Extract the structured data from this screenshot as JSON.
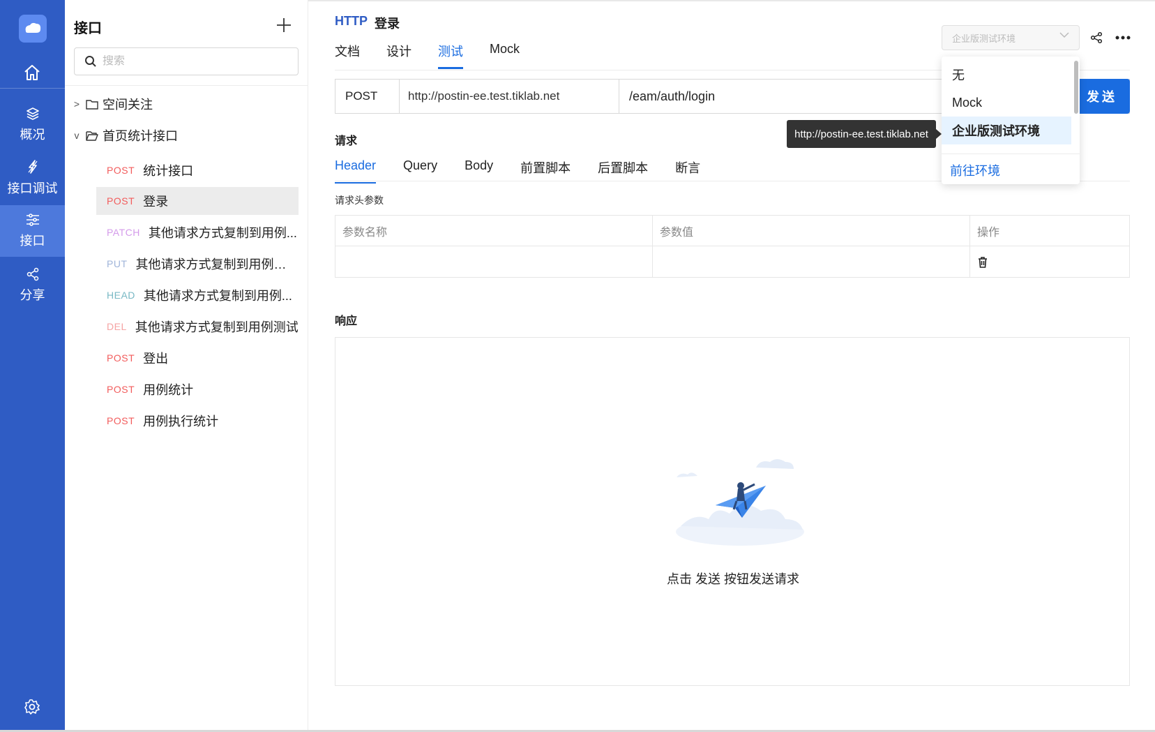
{
  "rail": {
    "items": [
      {
        "label": "概况",
        "icon": "layers-icon"
      },
      {
        "label": "接口调试",
        "icon": "lightning-icon"
      },
      {
        "label": "接口",
        "icon": "sliders-icon"
      },
      {
        "label": "分享",
        "icon": "share-icon"
      }
    ],
    "colors": {
      "background": "#2f5cc4",
      "active": "#4d79dc"
    }
  },
  "tree": {
    "title": "接口",
    "search_placeholder": "搜索",
    "folders": [
      {
        "label": "空间关注",
        "expanded": false
      },
      {
        "label": "首页统计接口",
        "expanded": true
      }
    ],
    "apis": [
      {
        "method": "POST",
        "name": "统计接口",
        "color": "#f25c5c"
      },
      {
        "method": "POST",
        "name": "登录",
        "color": "#f25c5c"
      },
      {
        "method": "PATCH",
        "name": "其他请求方式复制到用例...",
        "color": "#d49bea"
      },
      {
        "method": "PUT",
        "name": "其他请求方式复制到用例测试",
        "color": "#9fb4d9"
      },
      {
        "method": "HEAD",
        "name": "其他请求方式复制到用例...",
        "color": "#78b8c4"
      },
      {
        "method": "DEL",
        "name": "其他请求方式复制到用例测试",
        "color": "#f5a3a3"
      },
      {
        "method": "POST",
        "name": "登出",
        "color": "#f25c5c"
      },
      {
        "method": "POST",
        "name": "用例统计",
        "color": "#f25c5c"
      },
      {
        "method": "POST",
        "name": "用例执行统计",
        "color": "#f25c5c"
      }
    ]
  },
  "header": {
    "protocol": "HTTP",
    "title": "登录",
    "tabs": [
      "文档",
      "设计",
      "测试",
      "Mock"
    ]
  },
  "request": {
    "method": "POST",
    "host": "http://postin-ee.test.tiklab.net",
    "path": "/eam/auth/login",
    "send_label": "发送",
    "section_title": "请求",
    "tabs": [
      "Header",
      "Query",
      "Body",
      "前置脚本",
      "后置脚本",
      "断言"
    ],
    "header_label": "请求头参数",
    "columns": [
      "参数名称",
      "参数值",
      "操作"
    ]
  },
  "response": {
    "section_title": "响应",
    "empty_text": "点击 发送 按钮发送请求"
  },
  "env": {
    "selected": "企业版测试环境",
    "options": [
      "无",
      "Mock",
      "企业版测试环境"
    ],
    "link": "前往环境",
    "tooltip": "http://postin-ee.test.tiklab.net"
  },
  "colors": {
    "accent": "#1a6ce0"
  }
}
